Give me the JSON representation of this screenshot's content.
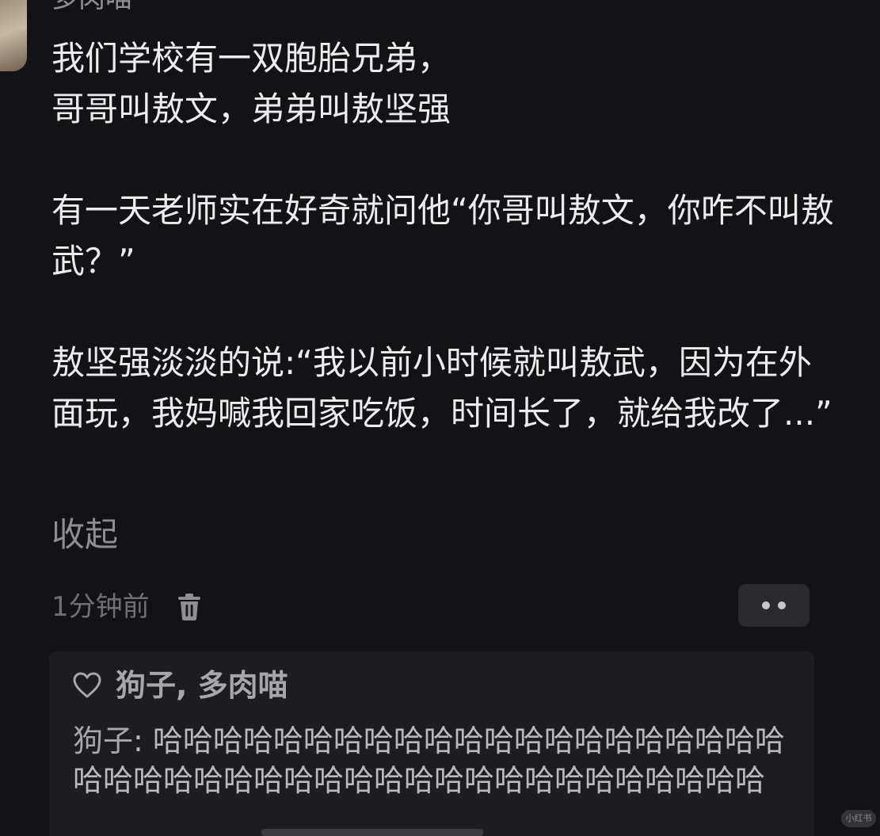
{
  "post": {
    "author": "多肉喵",
    "text": "我们学校有一双胞胎兄弟，\n哥哥叫敖文，弟弟叫敖坚强\n\n有一天老师实在好奇就问他“你哥叫敖文，你咋不叫敖武？”\n\n敖坚强淡淡的说:“我以前小时候就叫敖武，因为在外面玩，我妈喊我回家吃饭，时间长了，就给我改了...”",
    "collapse_label": "收起",
    "timestamp": "1分钟前",
    "delete_icon": "trash-icon",
    "more_icon": "more-dots-icon"
  },
  "reply": {
    "likes_icon": "heart-icon",
    "liked_by": "狗子, 多肉喵",
    "author": "狗子",
    "separator": ": ",
    "text": "哈哈哈哈哈哈哈哈哈哈哈哈哈哈哈哈哈哈哈哈哈哈哈哈哈哈哈哈哈哈哈哈哈哈哈哈哈哈哈哈哈哈哈哈"
  },
  "watermark": {
    "label": "小红书"
  },
  "colors": {
    "background": "#131316",
    "text_primary": "#ececee",
    "text_secondary": "#8e8e93",
    "reply_background": "#1d1d20",
    "button_background": "#2a2a2e"
  }
}
